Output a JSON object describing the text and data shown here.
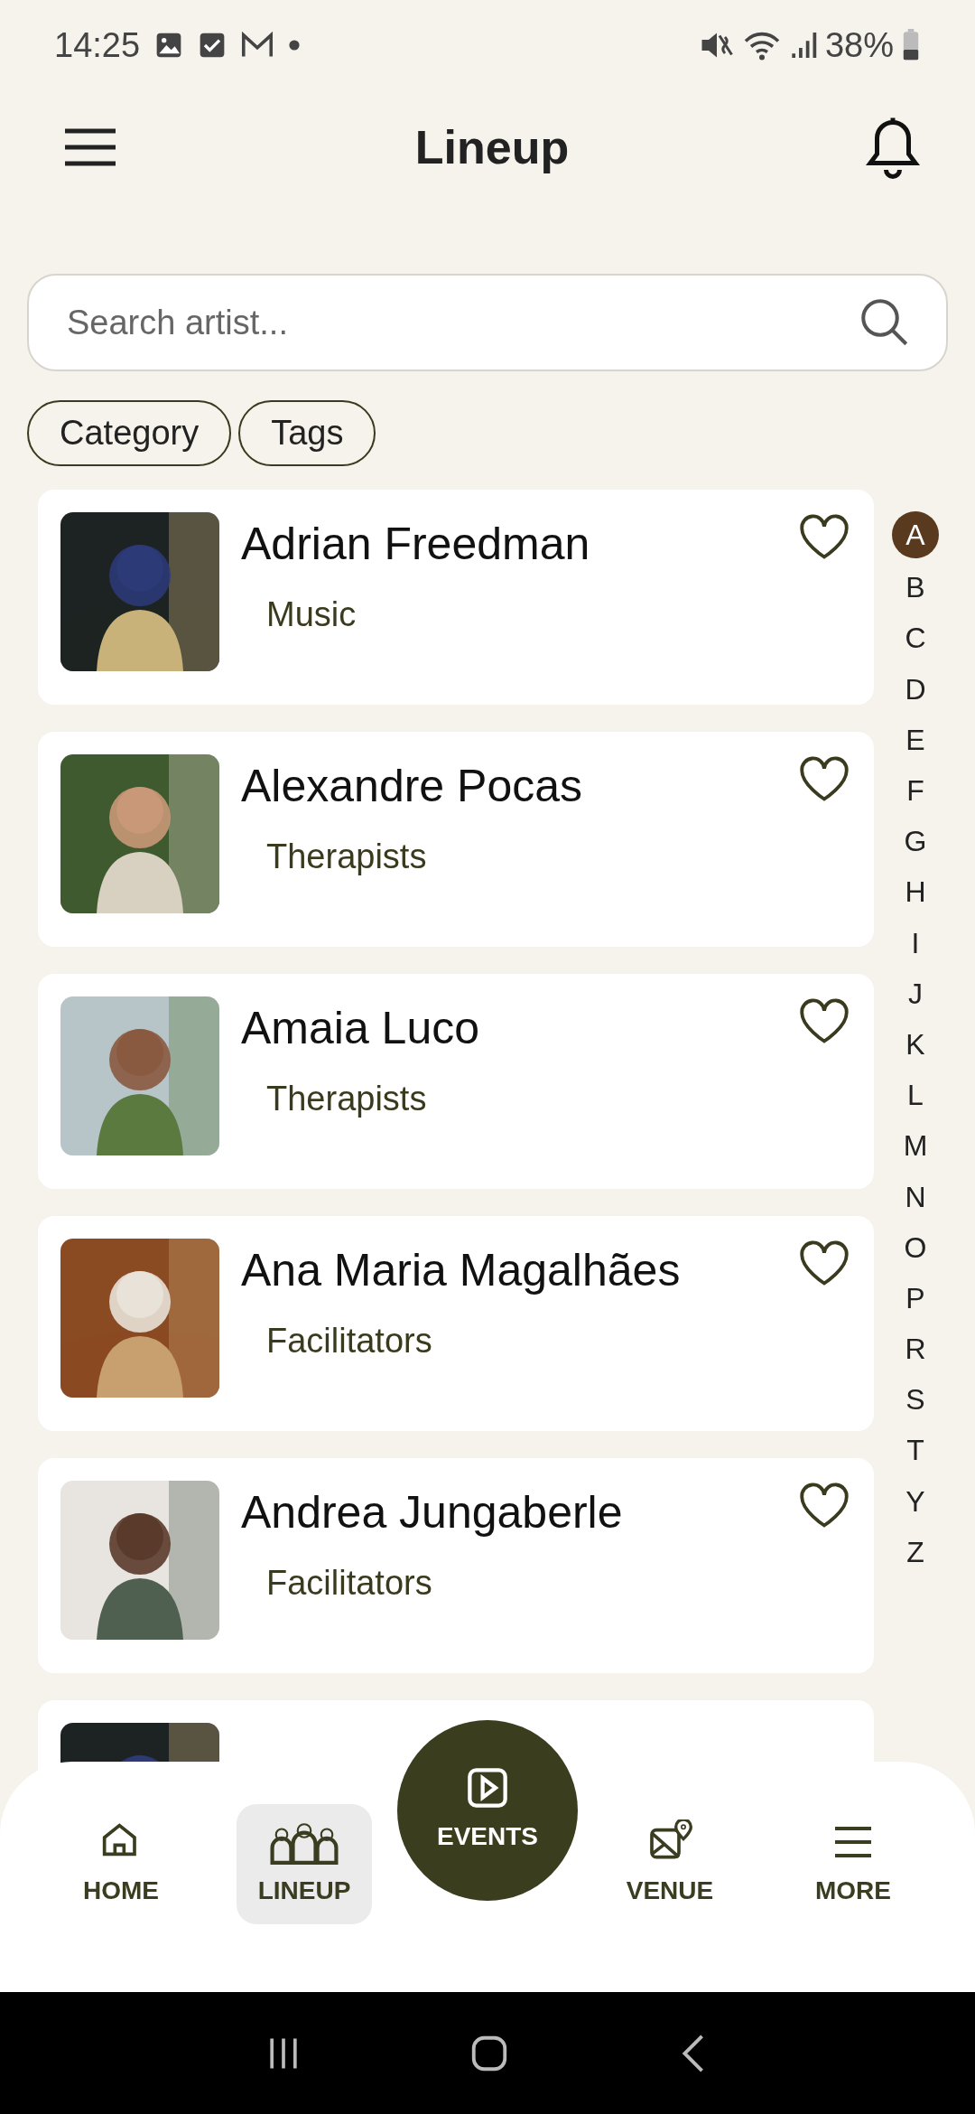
{
  "status_bar": {
    "time": "14:25",
    "battery": "38%"
  },
  "header": {
    "title": "Lineup"
  },
  "search": {
    "placeholder": "Search artist..."
  },
  "filters": [
    {
      "label": "Category"
    },
    {
      "label": "Tags"
    }
  ],
  "artists": [
    {
      "name": "Adrian Freedman",
      "category": "Music",
      "favorite": false
    },
    {
      "name": "Alexandre Pocas",
      "category": "Therapists",
      "favorite": false
    },
    {
      "name": "Amaia Luco",
      "category": "Therapists",
      "favorite": false
    },
    {
      "name": "Ana Maria Magalhães",
      "category": "Facilitators",
      "favorite": false
    },
    {
      "name": "Andrea Jungaberle",
      "category": "Facilitators",
      "favorite": false
    }
  ],
  "alphabet": [
    {
      "letter": "A",
      "selected": true
    },
    {
      "letter": "B",
      "selected": false
    },
    {
      "letter": "C",
      "selected": false
    },
    {
      "letter": "D",
      "selected": false
    },
    {
      "letter": "E",
      "selected": false
    },
    {
      "letter": "F",
      "selected": false
    },
    {
      "letter": "G",
      "selected": false
    },
    {
      "letter": "H",
      "selected": false
    },
    {
      "letter": "I",
      "selected": false
    },
    {
      "letter": "J",
      "selected": false
    },
    {
      "letter": "K",
      "selected": false
    },
    {
      "letter": "L",
      "selected": false
    },
    {
      "letter": "M",
      "selected": false
    },
    {
      "letter": "N",
      "selected": false
    },
    {
      "letter": "O",
      "selected": false
    },
    {
      "letter": "P",
      "selected": false
    },
    {
      "letter": "R",
      "selected": false
    },
    {
      "letter": "S",
      "selected": false
    },
    {
      "letter": "T",
      "selected": false
    },
    {
      "letter": "Y",
      "selected": false
    },
    {
      "letter": "Z",
      "selected": false
    }
  ],
  "bottom_nav": [
    {
      "label": "HOME",
      "kind": "home",
      "selected": false
    },
    {
      "label": "LINEUP",
      "kind": "lineup",
      "selected": true
    },
    {
      "label": "EVENTS",
      "kind": "events",
      "selected": false
    },
    {
      "label": "VENUE",
      "kind": "venue",
      "selected": false
    },
    {
      "label": "MORE",
      "kind": "more",
      "selected": false
    }
  ]
}
